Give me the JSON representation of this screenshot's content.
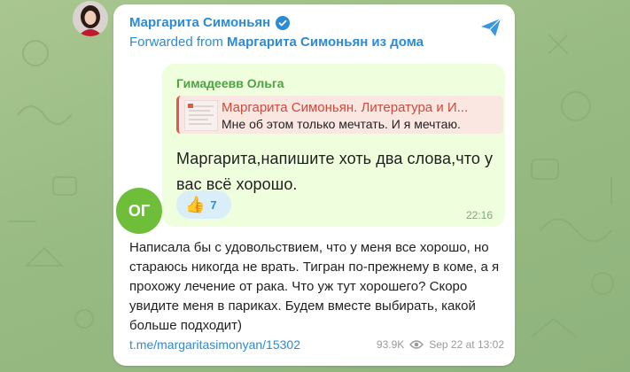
{
  "channel": {
    "name": "Маргарита Симоньян",
    "forwarded_prefix": "Forwarded from",
    "forwarded_source": "Маргарита Симоньян из дома"
  },
  "reply": {
    "author": "Гимадеевв Ольга",
    "quote_title": "Маргарита Симоньян. Литература и И...",
    "quote_text": "Мне об этом только мечтать. И я мечтаю.",
    "message": "Маргарита,напишите хоть два слова,что у вас всё хорошо.",
    "reaction_emoji": "👍",
    "reaction_count": "7",
    "time": "22:16",
    "avatar_initials": "ОГ"
  },
  "post": {
    "body": "Написала бы с удовольствием, что у меня все хорошо, но стараюсь никогда не врать. Тигран по-прежнему в коме, а я прохожу лечение от рака. Что уж тут хорошего? Скоро увидите меня в париках. Будем вместе выбирать, какой больше подходит)",
    "link": "t.me/margaritasimonyan/15302",
    "views": "93.9K",
    "date": "Sep 22 at 13:02"
  },
  "colors": {
    "accent": "#2a8bd6",
    "reply_author": "#4fa144",
    "quote_accent": "#e05a47",
    "avatar_green": "#6fbe3a"
  }
}
